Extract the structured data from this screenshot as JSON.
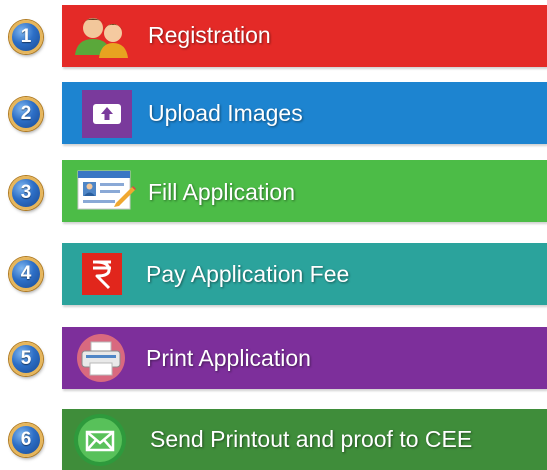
{
  "steps": [
    {
      "number": "1",
      "label": "Registration",
      "icon": "users-icon",
      "color": "#e42a27"
    },
    {
      "number": "2",
      "label": "Upload Images",
      "icon": "upload-icon",
      "color": "#1d84d0"
    },
    {
      "number": "3",
      "label": "Fill Application",
      "icon": "form-edit-icon",
      "color": "#4cbc47"
    },
    {
      "number": "4",
      "label": "Pay Application Fee",
      "icon": "rupee-icon",
      "color": "#2ba39c"
    },
    {
      "number": "5",
      "label": "Print Application",
      "icon": "printer-icon",
      "color": "#7d2f9b"
    },
    {
      "number": "6",
      "label": "Send Printout and proof to CEE",
      "icon": "mail-icon",
      "color": "#3f8d3a"
    }
  ]
}
